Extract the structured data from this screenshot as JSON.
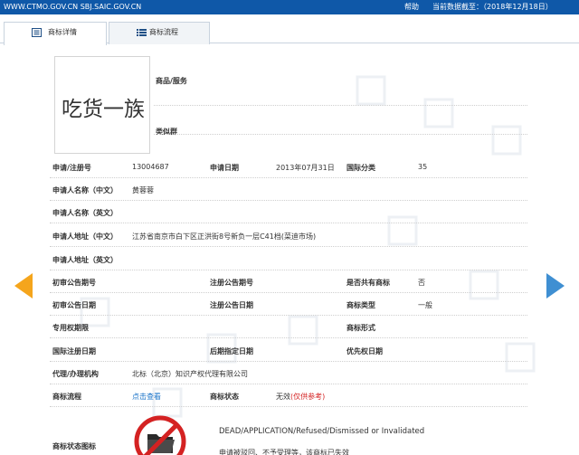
{
  "topbar": {
    "site": "WWW.CTMO.GOV.CN SBJ.SAIC.GOV.CN",
    "help": "帮助",
    "date_text": "当前数据截至：（2018年12月18日）",
    "bg_color": "#0f58a8"
  },
  "tabs": [
    {
      "label": "商标详情",
      "icon": "document-icon",
      "active": true
    },
    {
      "label": "商标流程",
      "icon": "list-icon",
      "active": false
    }
  ],
  "trademark_image": {
    "text": "吃货一族"
  },
  "goods_services": {
    "label": "商品/服务"
  },
  "similar_group": {
    "label": "类似群"
  },
  "details": {
    "app_no_label": "申请/注册号",
    "app_no_value": "13004687",
    "app_date_label": "申请日期",
    "app_date_value": "2013年07月31日",
    "intl_class_label": "国际分类",
    "intl_class_value": "35",
    "applicant_cn_label": "申请人名称（中文）",
    "applicant_cn_value": "黄蓉蓉",
    "applicant_en_label": "申请人名称（英文）",
    "address_cn_label": "申请人地址（中文）",
    "address_cn_value": "江苏省南京市白下区正洪街8号新负一层C41档(菜迪市场)",
    "address_en_label": "申请人地址（英文）",
    "prelim_pub_no_label": "初审公告期号",
    "reg_pub_no_label": "注册公告期号",
    "shared_label": "是否共有商标",
    "shared_value": "否",
    "prelim_pub_date_label": "初审公告日期",
    "reg_pub_date_label": "注册公告日期",
    "tm_type_label": "商标类型",
    "tm_type_value": "一般",
    "exclusive_label": "专用权期限",
    "tm_form_label": "商标形式",
    "intl_reg_date_label": "国际注册日期",
    "later_date_label": "后期指定日期",
    "priority_date_label": "优先权日期",
    "agent_label": "代理/办理机构",
    "agent_value": "北标（北京）知识产权代理有限公司",
    "flow_label": "商标流程",
    "flow_link": "点击查看",
    "status_label": "商标状态",
    "status_value": "无效",
    "status_note": "(仅供参考)",
    "status_icon_label": "商标状态图标",
    "status_en": "DEAD/APPLICATION/Refused/Dismissed or Invalidated",
    "status_cn": "申请被驳回、不予受理等，该商标已失效"
  },
  "nav": {
    "prev_color": "#f5a51c",
    "next_color": "#3f8fd2"
  }
}
